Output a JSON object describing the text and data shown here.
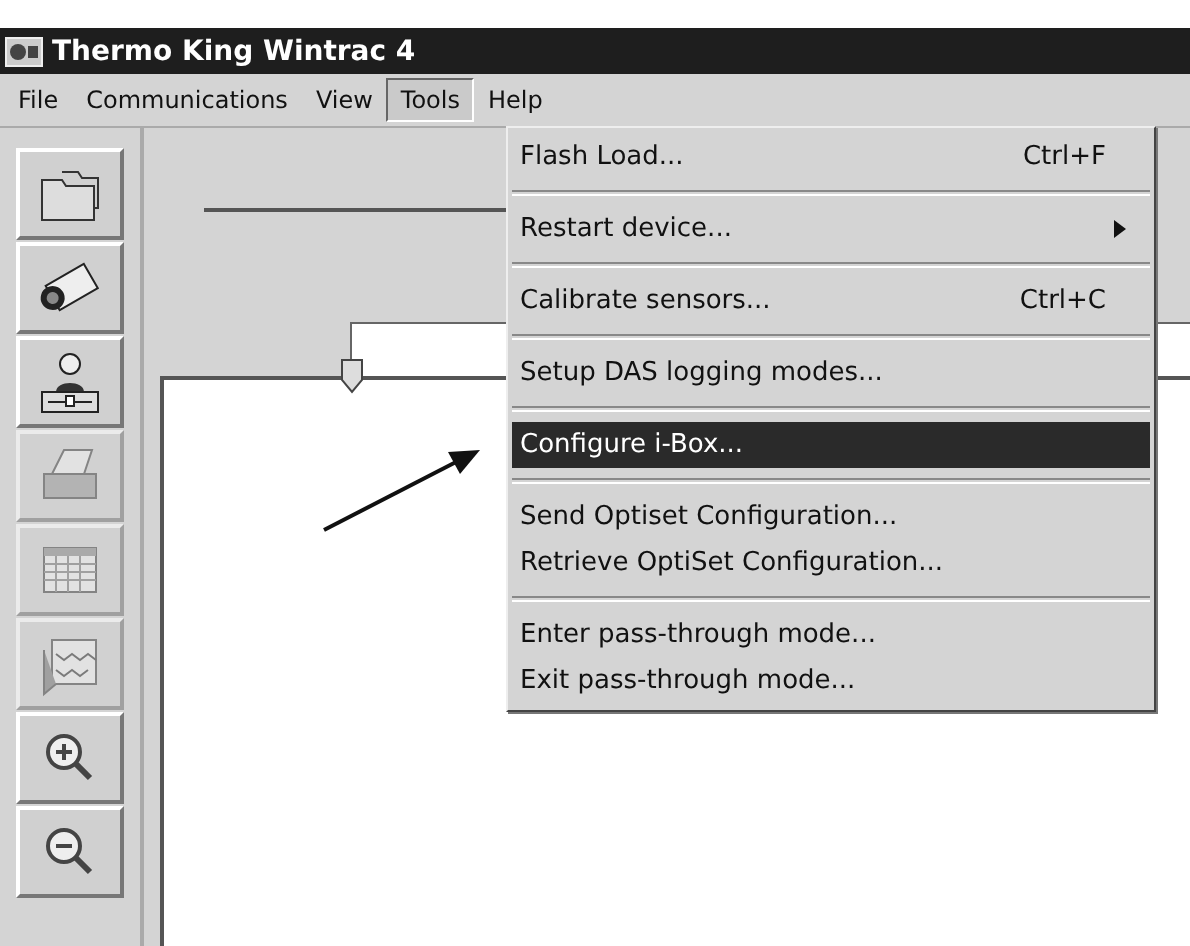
{
  "window": {
    "title": "Thermo King Wintrac 4"
  },
  "menubar": [
    {
      "label": "File",
      "selected": false
    },
    {
      "label": "Communications",
      "selected": false
    },
    {
      "label": "View",
      "selected": false
    },
    {
      "label": "Tools",
      "selected": true
    },
    {
      "label": "Help",
      "selected": false
    }
  ],
  "toolbar": [
    {
      "kind": "folder",
      "disabled": false
    },
    {
      "kind": "camera",
      "disabled": false
    },
    {
      "kind": "person",
      "disabled": false
    },
    {
      "kind": "printer",
      "disabled": true
    },
    {
      "kind": "calendar",
      "disabled": true
    },
    {
      "kind": "graph",
      "disabled": true
    },
    {
      "kind": "zoomin",
      "disabled": false
    },
    {
      "kind": "zoomout",
      "disabled": false
    }
  ],
  "tools_menu": [
    {
      "kind": "item",
      "label": "Flash Load...",
      "shortcut": "Ctrl+F",
      "submenu": false,
      "selected": false
    },
    {
      "kind": "separator"
    },
    {
      "kind": "item",
      "label": "Restart device...",
      "submenu": true,
      "selected": false
    },
    {
      "kind": "separator"
    },
    {
      "kind": "item",
      "label": "Calibrate sensors...",
      "shortcut": "Ctrl+C",
      "submenu": false,
      "selected": false
    },
    {
      "kind": "separator"
    },
    {
      "kind": "item",
      "label": "Setup DAS logging modes...",
      "submenu": false,
      "selected": false
    },
    {
      "kind": "separator"
    },
    {
      "kind": "item",
      "label": "Configure i-Box...",
      "submenu": false,
      "selected": true
    },
    {
      "kind": "separator"
    },
    {
      "kind": "item",
      "label": "Send Optiset Configuration...",
      "submenu": false,
      "selected": false
    },
    {
      "kind": "item",
      "label": "Retrieve OptiSet Configuration...",
      "submenu": false,
      "selected": false
    },
    {
      "kind": "separator"
    },
    {
      "kind": "item",
      "label": "Enter pass-through mode...",
      "submenu": false,
      "selected": false
    },
    {
      "kind": "item",
      "label": "Exit pass-through mode...",
      "submenu": false,
      "selected": false
    }
  ]
}
